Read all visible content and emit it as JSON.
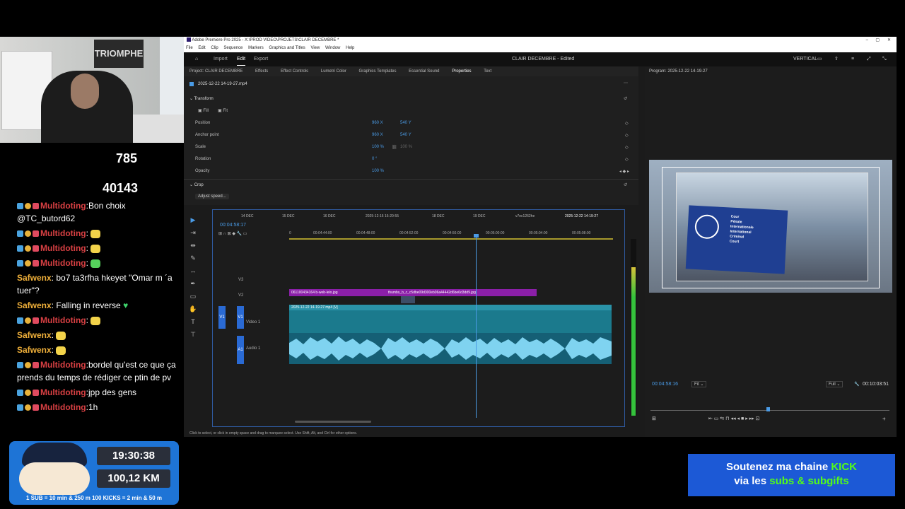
{
  "stream": {
    "stat_top": "785",
    "stat_bottom": "40143",
    "cam_sign": "TRIOMPHE",
    "chat": [
      {
        "user": "Multidoting",
        "type": "red",
        "text": "Bon choix @TC_butord62"
      },
      {
        "user": "Multidoting",
        "type": "red",
        "text": ""
      },
      {
        "user": "Multidoting",
        "type": "red",
        "text": ""
      },
      {
        "user": "Multidoting",
        "type": "red",
        "text": ""
      },
      {
        "user": "Safwenx",
        "type": "orange",
        "text": "bo7 ta3rfha hkeyet \"Omar m ´a tuer\"?"
      },
      {
        "user": "Safwenx",
        "type": "orange",
        "text": "Falling in reverse"
      },
      {
        "user": "Multidoting",
        "type": "red",
        "text": ""
      },
      {
        "user": "Safwenx",
        "type": "orange",
        "text": ""
      },
      {
        "user": "Safwenx",
        "type": "orange",
        "text": ""
      },
      {
        "user": "Multidoting",
        "type": "red",
        "text": "bordel qu'est ce que ça prends du temps de rédiger ce ptin de pv"
      },
      {
        "user": "Multidoting",
        "type": "red",
        "text": "jpp des gens"
      },
      {
        "user": "Multidoting",
        "type": "red",
        "text": "1h"
      }
    ],
    "panel": {
      "time": "19:30:38",
      "distance": "100,12 KM",
      "footer": "1 SUB = 10 min & 250 m    100 KICKS = 2 min & 50 m"
    },
    "kick": {
      "line1_a": "Soutenez ma chaine ",
      "line1_b": "KICK",
      "line2_a": "via les ",
      "line2_b": "subs & subgifts"
    }
  },
  "premiere": {
    "title": "Adobe Premiere Pro 2025 - X:\\PROD VIDEO\\PROJETS\\CLAIR DECEMBRE *",
    "menu": [
      "File",
      "Edit",
      "Clip",
      "Sequence",
      "Markers",
      "Graphics and Titles",
      "View",
      "Window",
      "Help"
    ],
    "header_tabs": [
      "Import",
      "Edit",
      "Export"
    ],
    "doc_title": "CLAIR DECEMBRE - Edited",
    "layout_mode": "VERTICAL",
    "panel_tabs": [
      "Project: CLAIR DECEMBRE",
      "Effects",
      "Effect Controls",
      "Lumetri Color",
      "Graphics Templates",
      "Essential Sound",
      "Properties",
      "Text"
    ],
    "clip_name": "2025-12-22 14-19-27.mp4",
    "transform_label": "Transform",
    "fill_label": "Fill",
    "fit_label": "Fit",
    "properties": [
      {
        "name": "Position",
        "v1": "960 X",
        "v2": "540 Y"
      },
      {
        "name": "Anchor point",
        "v1": "960 X",
        "v2": "540 Y"
      },
      {
        "name": "Scale",
        "v1": "100 %",
        "v2": "100 %"
      },
      {
        "name": "Rotation",
        "v1": "0 °",
        "v2": ""
      },
      {
        "name": "Opacity",
        "v1": "100 %",
        "v2": ""
      }
    ],
    "crop_label": "Crop",
    "adjust_speed": "Adjust speed...",
    "sequence_tabs": [
      "14 DEC",
      "15 DEC",
      "16 DEC",
      "2025-12-16 16-20-55",
      "18 DEC",
      "19 DEC",
      "v7ec1262he",
      "2025-12-22 14-19-27"
    ],
    "timecode": "00:04:58:17",
    "ruler": [
      "0",
      "00:04:44:00",
      "00:04:48:00",
      "00:04:52:00",
      "00:04:56:00",
      "00:05:00:00",
      "00:05:04:00",
      "00:05:08:00"
    ],
    "tracks": {
      "v3": "V3",
      "v2": "V2",
      "v1": "V1",
      "video1": "Video 1",
      "a1": "A1",
      "audio1": "Audio 1"
    },
    "clips": {
      "v2_a": "061100434164 b-web-lelo.jpg",
      "v2_b": "thumbs_b_c_c5dbe09d300eb06a44442d6be6d3dd9.jpg",
      "v1": "2025-12-22 14-19-27.mp4 [V]"
    },
    "program_title": "Program: 2025-12-22 14-19-27",
    "program_tc": "00:04:58:16",
    "fit": "Fit",
    "full": "Full",
    "duration": "00:10:03:51",
    "status": "Click to select, or click in empty space and drag to marquee select. Use Shift, Alt, and Ctrl for other options.",
    "icc_text": [
      "Cour",
      "Pénale",
      "Internationale",
      "International",
      "Criminal",
      "Court"
    ]
  }
}
